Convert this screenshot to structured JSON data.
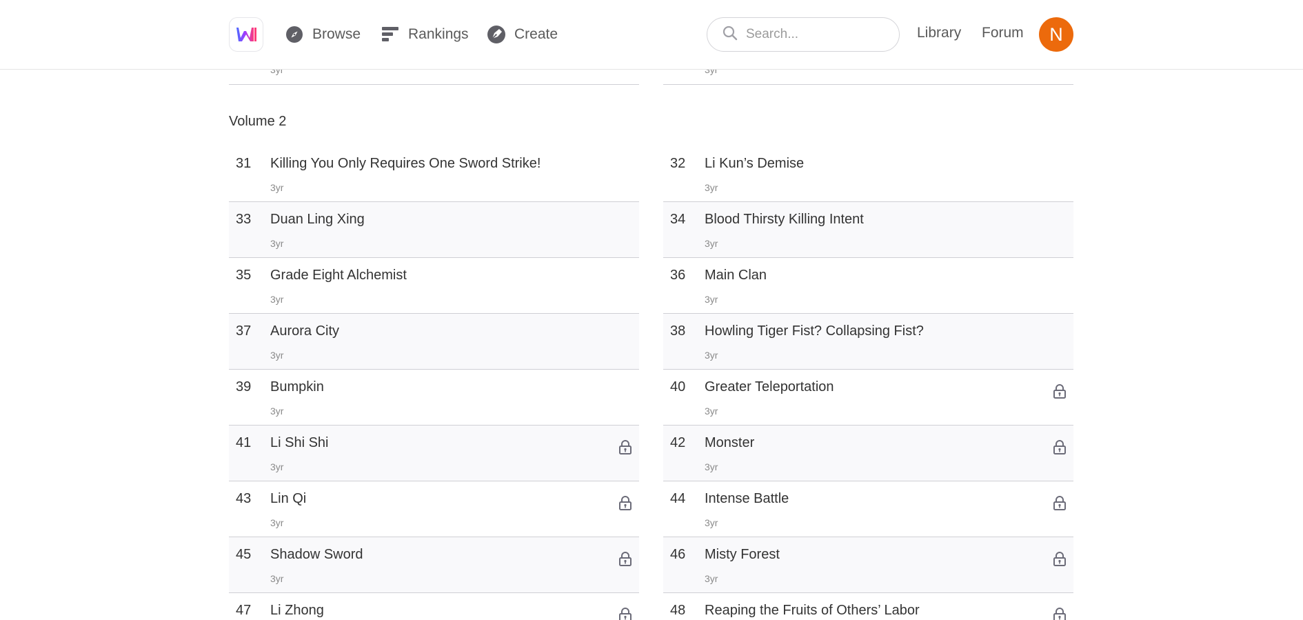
{
  "header": {
    "logo_icon": "app-logo-icon",
    "nav": [
      {
        "label": "Browse",
        "icon": "compass-icon"
      },
      {
        "label": "Rankings",
        "icon": "rankings-bars-icon"
      },
      {
        "label": "Create",
        "icon": "pen-nib-icon"
      }
    ],
    "search": {
      "placeholder": "Search...",
      "icon": "search-icon"
    },
    "library_label": "Library",
    "forum_label": "Forum",
    "avatar_initial": "N",
    "avatar_color": "#ec6a0c"
  },
  "previous_row": {
    "left_time": "3yr",
    "right_time": "3yr"
  },
  "volume": {
    "title": "Volume 2",
    "chapters": [
      {
        "num": "31",
        "title": "Killing You Only Requires One Sword Strike!",
        "time": "3yr",
        "locked": false
      },
      {
        "num": "32",
        "title": "Li Kun’s Demise",
        "time": "3yr",
        "locked": false
      },
      {
        "num": "33",
        "title": "Duan Ling Xing",
        "time": "3yr",
        "locked": false
      },
      {
        "num": "34",
        "title": "Blood Thirsty Killing Intent",
        "time": "3yr",
        "locked": false
      },
      {
        "num": "35",
        "title": "Grade Eight Alchemist",
        "time": "3yr",
        "locked": false
      },
      {
        "num": "36",
        "title": "Main Clan",
        "time": "3yr",
        "locked": false
      },
      {
        "num": "37",
        "title": "Aurora City",
        "time": "3yr",
        "locked": false
      },
      {
        "num": "38",
        "title": "Howling Tiger Fist? Collapsing Fist?",
        "time": "3yr",
        "locked": false
      },
      {
        "num": "39",
        "title": "Bumpkin",
        "time": "3yr",
        "locked": false
      },
      {
        "num": "40",
        "title": "Greater Teleportation",
        "time": "3yr",
        "locked": true
      },
      {
        "num": "41",
        "title": "Li Shi Shi",
        "time": "3yr",
        "locked": true
      },
      {
        "num": "42",
        "title": "Monster",
        "time": "3yr",
        "locked": true
      },
      {
        "num": "43",
        "title": "Lin Qi",
        "time": "3yr",
        "locked": true
      },
      {
        "num": "44",
        "title": "Intense Battle",
        "time": "3yr",
        "locked": true
      },
      {
        "num": "45",
        "title": "Shadow Sword",
        "time": "3yr",
        "locked": true
      },
      {
        "num": "46",
        "title": "Misty Forest",
        "time": "3yr",
        "locked": true
      },
      {
        "num": "47",
        "title": "Li Zhong",
        "time": "",
        "locked": true
      },
      {
        "num": "48",
        "title": "Reaping the Fruits of Others’ Labor",
        "time": "",
        "locked": true
      }
    ]
  },
  "colors": {
    "lock": "#6b6b78",
    "divider": "#cfcfd4",
    "alt_row_bg": "#f9f9fb"
  }
}
